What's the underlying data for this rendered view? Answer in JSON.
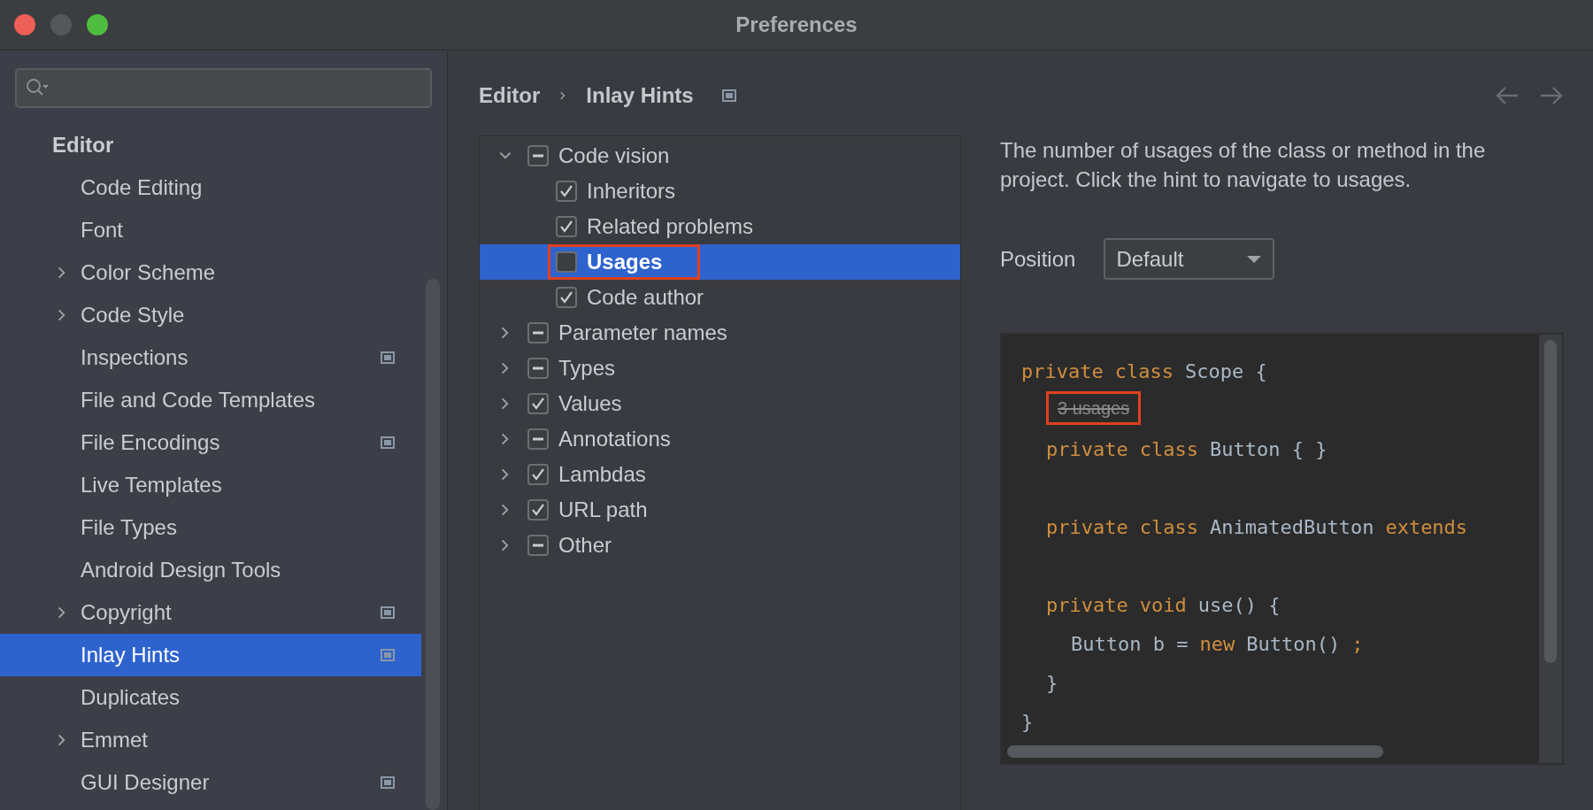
{
  "window": {
    "title": "Preferences"
  },
  "sidebar": {
    "heading": "Editor",
    "items": [
      {
        "label": "Code Editing",
        "expandable": false,
        "project_icon": false,
        "selected": false
      },
      {
        "label": "Font",
        "expandable": false,
        "project_icon": false,
        "selected": false
      },
      {
        "label": "Color Scheme",
        "expandable": true,
        "project_icon": false,
        "selected": false
      },
      {
        "label": "Code Style",
        "expandable": true,
        "project_icon": false,
        "selected": false
      },
      {
        "label": "Inspections",
        "expandable": false,
        "project_icon": true,
        "selected": false
      },
      {
        "label": "File and Code Templates",
        "expandable": false,
        "project_icon": false,
        "selected": false
      },
      {
        "label": "File Encodings",
        "expandable": false,
        "project_icon": true,
        "selected": false
      },
      {
        "label": "Live Templates",
        "expandable": false,
        "project_icon": false,
        "selected": false
      },
      {
        "label": "File Types",
        "expandable": false,
        "project_icon": false,
        "selected": false
      },
      {
        "label": "Android Design Tools",
        "expandable": false,
        "project_icon": false,
        "selected": false
      },
      {
        "label": "Copyright",
        "expandable": true,
        "project_icon": true,
        "selected": false
      },
      {
        "label": "Inlay Hints",
        "expandable": false,
        "project_icon": true,
        "selected": true
      },
      {
        "label": "Duplicates",
        "expandable": false,
        "project_icon": false,
        "selected": false
      },
      {
        "label": "Emmet",
        "expandable": true,
        "project_icon": false,
        "selected": false
      },
      {
        "label": "GUI Designer",
        "expandable": false,
        "project_icon": true,
        "selected": false
      }
    ]
  },
  "breadcrumb": [
    "Editor",
    "Inlay Hints"
  ],
  "tree": [
    {
      "label": "Code vision",
      "checked": false,
      "partial": true,
      "expanded": true,
      "selected": false,
      "highlighted": false,
      "children": [
        {
          "label": "Inheritors",
          "checked": true,
          "selected": false,
          "highlighted": false
        },
        {
          "label": "Related problems",
          "checked": true,
          "selected": false,
          "highlighted": false
        },
        {
          "label": "Usages",
          "checked": false,
          "partial": false,
          "selected": true,
          "highlighted": true
        },
        {
          "label": "Code author",
          "checked": true,
          "selected": false,
          "highlighted": false
        }
      ]
    },
    {
      "label": "Parameter names",
      "checked": false,
      "partial": true,
      "expanded": false,
      "selected": false,
      "highlighted": false
    },
    {
      "label": "Types",
      "checked": false,
      "partial": true,
      "expanded": false,
      "selected": false,
      "highlighted": false
    },
    {
      "label": "Values",
      "checked": true,
      "expanded": false,
      "selected": false,
      "highlighted": false
    },
    {
      "label": "Annotations",
      "checked": false,
      "partial": true,
      "expanded": false,
      "selected": false,
      "highlighted": false
    },
    {
      "label": "Lambdas",
      "checked": true,
      "expanded": false,
      "selected": false,
      "highlighted": false
    },
    {
      "label": "URL path",
      "checked": true,
      "expanded": false,
      "selected": false,
      "highlighted": false
    },
    {
      "label": "Other",
      "checked": false,
      "partial": true,
      "expanded": false,
      "selected": false,
      "highlighted": false
    }
  ],
  "description": "The number of usages of the class or method in the project. Click the hint to navigate to usages.",
  "position": {
    "label": "Position",
    "value": "Default"
  },
  "code_preview": [
    {
      "kind": "code",
      "tokens": [
        {
          "kind": "keyword",
          "text": "private"
        },
        {
          "kind": "keyword",
          "text": "class"
        },
        {
          "kind": "ident",
          "text": "Scope {"
        }
      ],
      "children": [
        {
          "kind": "inlay",
          "text": "3 usages",
          "highlighted": true
        },
        {
          "kind": "code",
          "tokens": [
            {
              "kind": "keyword",
              "text": "private"
            },
            {
              "kind": "keyword",
              "text": "class"
            },
            {
              "kind": "ident",
              "text": "Button { }"
            }
          ]
        },
        {
          "kind": "blank"
        },
        {
          "kind": "code",
          "tokens": [
            {
              "kind": "keyword",
              "text": "private"
            },
            {
              "kind": "keyword",
              "text": "class"
            },
            {
              "kind": "ident",
              "text": "AnimatedButton"
            },
            {
              "kind": "keyword",
              "text": "extends"
            }
          ]
        },
        {
          "kind": "blank"
        },
        {
          "kind": "code",
          "tokens": [
            {
              "kind": "keyword",
              "text": "private"
            },
            {
              "kind": "keyword",
              "text": "void"
            },
            {
              "kind": "ident",
              "text": "use() {"
            }
          ],
          "children": [
            {
              "kind": "code",
              "tokens": [
                {
                  "kind": "ident",
                  "text": "Button b ="
                },
                {
                  "kind": "keyword",
                  "text": "new"
                },
                {
                  "kind": "ident",
                  "text": "Button()"
                },
                {
                  "kind": "keyword",
                  "text": ";"
                }
              ]
            }
          ]
        },
        {
          "kind": "code",
          "tokens": [
            {
              "kind": "ident",
              "text": "}"
            }
          ]
        }
      ]
    },
    {
      "kind": "code",
      "tokens": [
        {
          "kind": "ident",
          "text": "}"
        }
      ]
    }
  ]
}
